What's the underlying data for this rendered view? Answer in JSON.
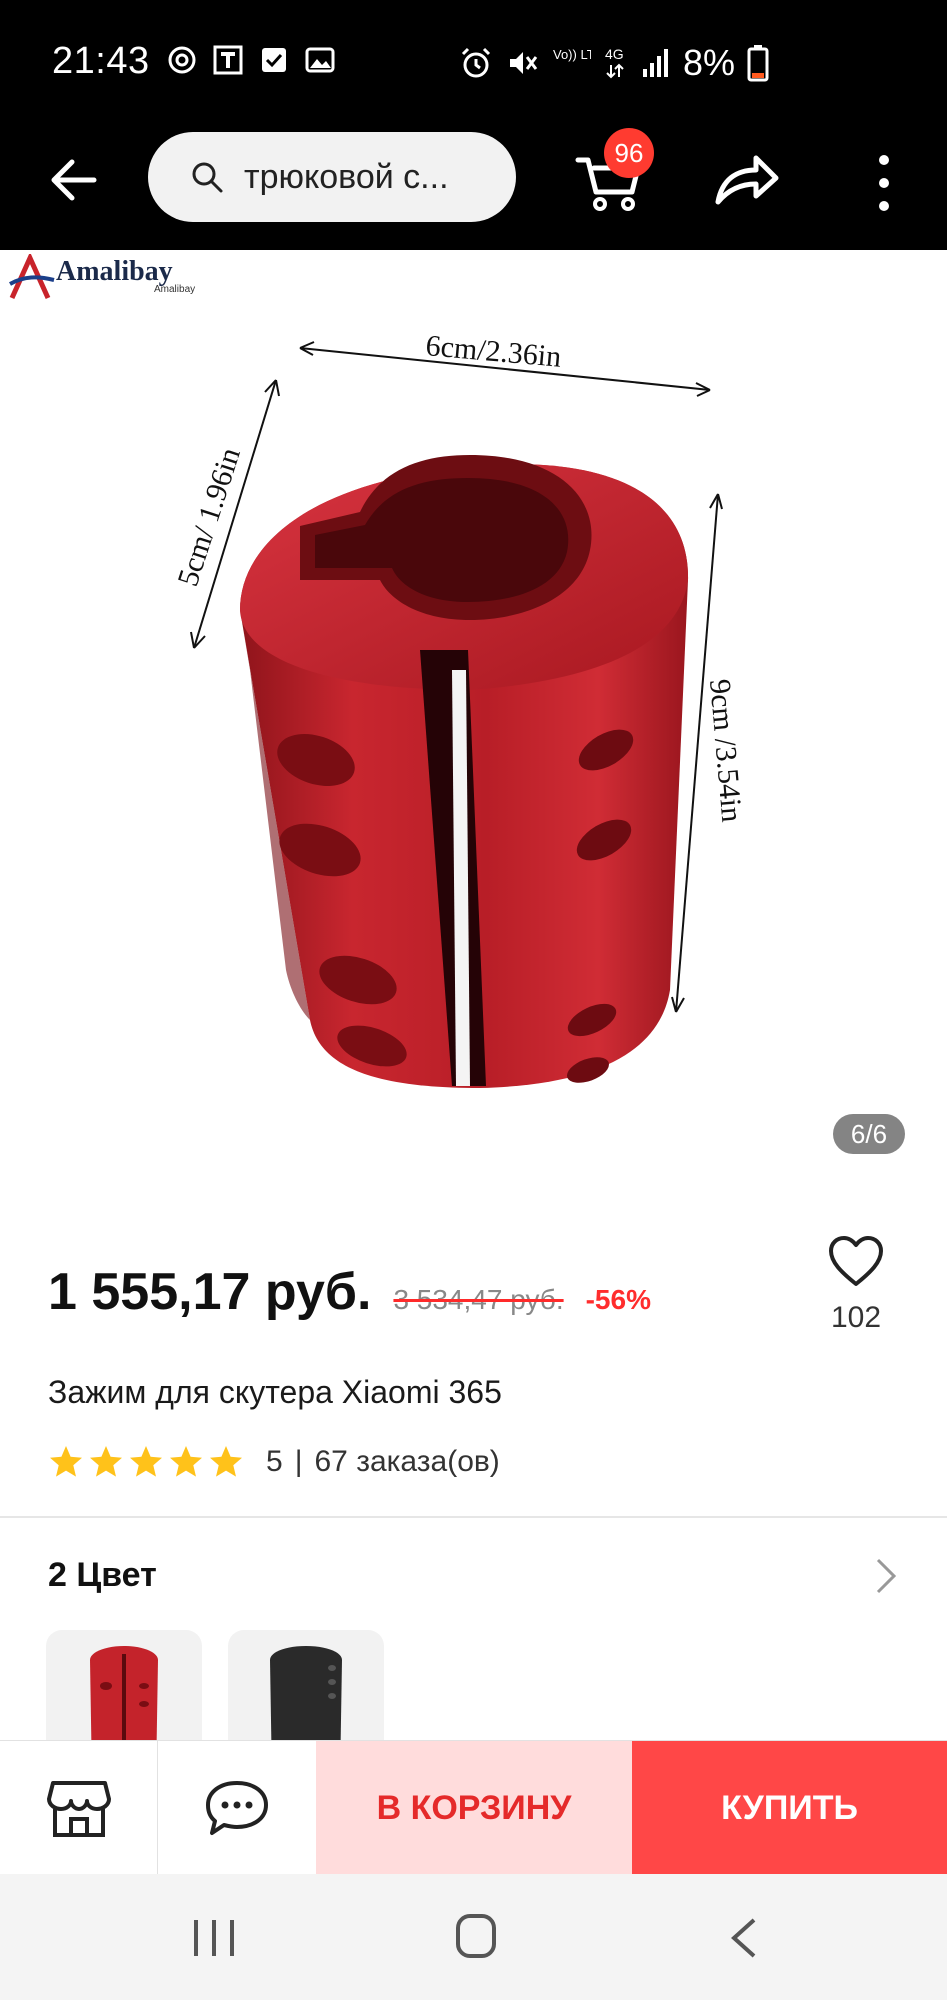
{
  "status_bar": {
    "time": "21:43",
    "network": "Vo)) LTE1",
    "network_type": "4G",
    "battery": "8%",
    "icons": [
      "sync-icon",
      "t-app-icon",
      "checkbox-icon",
      "image-icon",
      "alarm-icon",
      "mute-icon",
      "signal-icon",
      "battery-icon"
    ]
  },
  "app_bar": {
    "search_value": "трюковой с...",
    "cart_badge": "96"
  },
  "gallery": {
    "brand_name": "Amalibay",
    "brand_sub": "Amalibay",
    "dims": {
      "width": "6cm/2.36in",
      "depth": "5cm/ 1.96in",
      "height": "9cm /3.54in"
    },
    "page_indicator": "6/6",
    "product_color": "#c4232b"
  },
  "product": {
    "price": "1 555,17 руб.",
    "old_price": "3 534,47 руб.",
    "discount": "-56%",
    "favorites": "102",
    "title": "Зажим для скутера Xiaomi 365",
    "rating": "5",
    "rating_sep": "|",
    "orders": "67 заказа(ов)",
    "rating_fraction": 1.0
  },
  "colors": {
    "header": "2 Цвет",
    "options": [
      {
        "name": "red",
        "color": "#c4232b"
      },
      {
        "name": "black",
        "color": "#2a2a2a"
      }
    ]
  },
  "actions": {
    "add_to_cart": "В КОРЗИНУ",
    "buy": "КУПИТЬ"
  },
  "colors_theme": {
    "accent": "#ff4747",
    "accent_light": "#ffdcdc",
    "star": "#ffc21a"
  }
}
